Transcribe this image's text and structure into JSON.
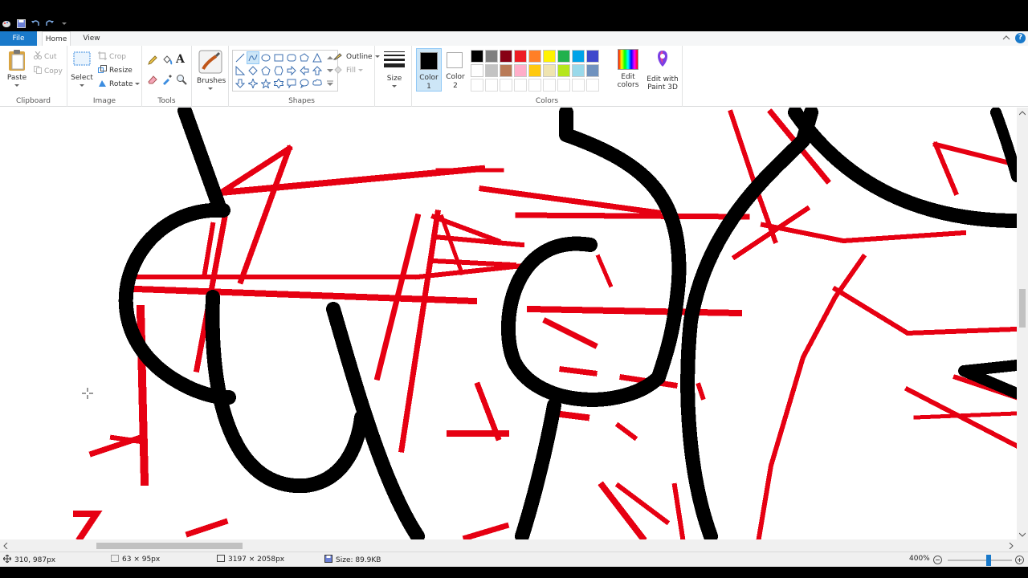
{
  "tabs": {
    "file": "File",
    "home": "Home",
    "view": "View"
  },
  "help": "?",
  "clipboard": {
    "paste": "Paste",
    "cut": "Cut",
    "copy": "Copy",
    "label": "Clipboard"
  },
  "image": {
    "select": "Select",
    "crop": "Crop",
    "resize": "Resize",
    "rotate": "Rotate",
    "label": "Image"
  },
  "tools": {
    "label": "Tools"
  },
  "brushes": {
    "label": "Brushes"
  },
  "shapes": {
    "outline": "Outline",
    "fill": "Fill",
    "label": "Shapes"
  },
  "size": {
    "label": "Size"
  },
  "colors": {
    "color1_line1": "Color",
    "color1_line2": "1",
    "color2_line1": "Color",
    "color2_line2": "2",
    "edit_colors_line1": "Edit",
    "edit_colors_line2": "colors",
    "paint3d_line1": "Edit with",
    "paint3d_line2": "Paint 3D",
    "label": "Colors",
    "palette": [
      "#000000",
      "#7f7f7f",
      "#880015",
      "#ed1c24",
      "#ff7f27",
      "#fff200",
      "#22b14c",
      "#00a2e8",
      "#3f48cc",
      "#a349a4",
      "#ffffff",
      "#c3c3c3",
      "#b97a57",
      "#ffaec9",
      "#ffc90e",
      "#efe4b0",
      "#b5e61d",
      "#99d9ea",
      "#7092be",
      "#c8bfe7"
    ],
    "color1": "#000000",
    "color2": "#ffffff",
    "ink_red": "#e60012"
  },
  "status": {
    "cursor_pos": "310, 987px",
    "selection_size": "63 × 95px",
    "image_size": "3197 × 2058px",
    "file_size": "Size: 89.9KB",
    "zoom": "400%"
  }
}
